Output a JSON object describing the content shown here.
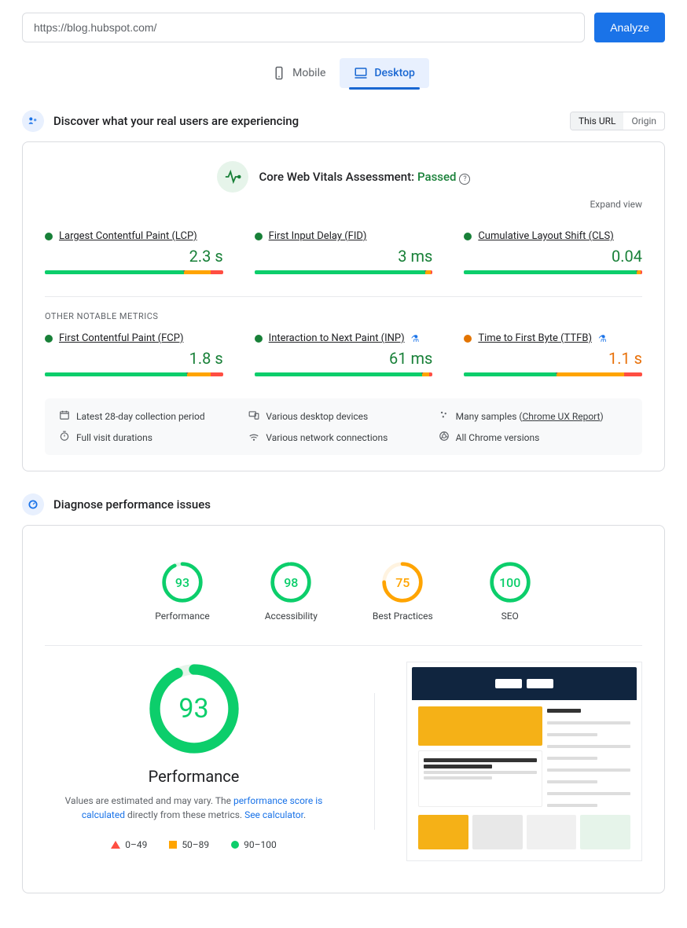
{
  "url": "https://blog.hubspot.com/",
  "analyze_label": "Analyze",
  "tabs": {
    "mobile": "Mobile",
    "desktop": "Desktop"
  },
  "crux": {
    "heading": "Discover what your real users are experiencing",
    "this_url": "This URL",
    "origin": "Origin",
    "cwv_title": "Core Web Vitals Assessment:",
    "cwv_status": "Passed",
    "expand": "Expand view",
    "metrics": [
      {
        "name": "Largest Contentful Paint (LCP)",
        "value": "2.3 s",
        "status": "green",
        "bar": [
          78,
          15,
          7
        ],
        "marker": 78
      },
      {
        "name": "First Input Delay (FID)",
        "value": "3 ms",
        "status": "green",
        "bar": [
          96,
          3,
          1
        ],
        "marker": 96
      },
      {
        "name": "Cumulative Layout Shift (CLS)",
        "value": "0.04",
        "status": "green",
        "bar": [
          97,
          2,
          1
        ],
        "marker": 97
      }
    ],
    "other_label": "OTHER NOTABLE METRICS",
    "other_metrics": [
      {
        "name": "First Contentful Paint (FCP)",
        "value": "1.8 s",
        "status": "green",
        "bar": [
          80,
          13,
          7
        ],
        "marker": 80,
        "beaker": false
      },
      {
        "name": "Interaction to Next Paint (INP)",
        "value": "61 ms",
        "status": "green",
        "bar": [
          94,
          4,
          2
        ],
        "marker": 94,
        "beaker": true
      },
      {
        "name": "Time to First Byte (TTFB)",
        "value": "1.1 s",
        "status": "orange",
        "bar": [
          52,
          38,
          10
        ],
        "marker": 52,
        "beaker": true
      }
    ],
    "footer": [
      {
        "icon": "calendar",
        "text": "Latest 28-day collection period"
      },
      {
        "icon": "devices",
        "text": "Various desktop devices"
      },
      {
        "icon": "samples",
        "text": "Many samples",
        "link": "Chrome UX Report"
      },
      {
        "icon": "timer",
        "text": "Full visit durations"
      },
      {
        "icon": "network",
        "text": "Various network connections"
      },
      {
        "icon": "chrome",
        "text": "All Chrome versions"
      }
    ]
  },
  "diagnose": {
    "heading": "Diagnose performance issues",
    "gauges": [
      {
        "label": "Performance",
        "value": 93,
        "color": "#0cce6b"
      },
      {
        "label": "Accessibility",
        "value": 98,
        "color": "#0cce6b"
      },
      {
        "label": "Best Practices",
        "value": 75,
        "color": "#ffa400"
      },
      {
        "label": "SEO",
        "value": 100,
        "color": "#0cce6b"
      }
    ],
    "big": {
      "value": 93,
      "title": "Performance",
      "desc_pre": "Values are estimated and may vary. The ",
      "link1": "performance score is calculated",
      "desc_mid": " directly from these metrics. ",
      "link2": "See calculator",
      "dot": "."
    },
    "legend": [
      {
        "range": "0–49",
        "shape": "tri"
      },
      {
        "range": "50–89",
        "shape": "sq"
      },
      {
        "range": "90–100",
        "shape": "ci"
      }
    ]
  }
}
